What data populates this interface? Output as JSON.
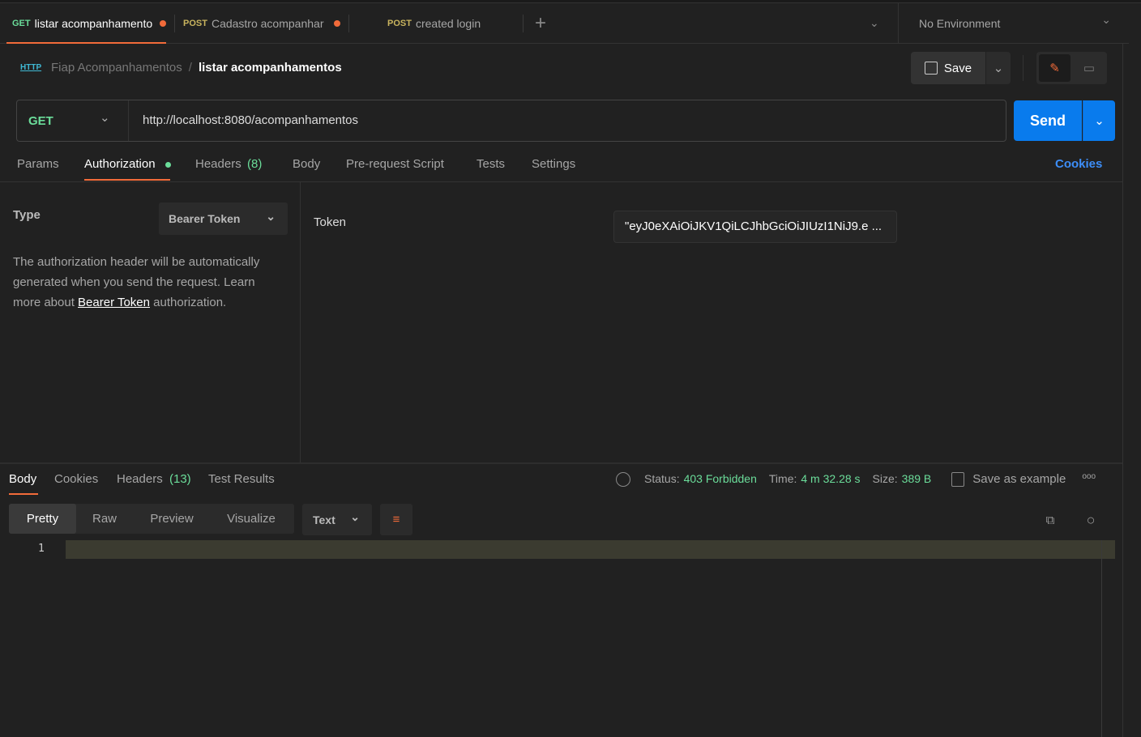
{
  "tabs": [
    {
      "method": "GET",
      "name": "listar acompanhamento",
      "dirty": true
    },
    {
      "method": "POST",
      "name": "Cadastro acompanhar",
      "dirty": true
    },
    {
      "method": "POST",
      "name": "created login",
      "dirty": false
    }
  ],
  "environment": "No Environment",
  "breadcrumb": {
    "collection": "Fiap Acompanhamentos",
    "separator": "/",
    "request": "listar acompanhamentos",
    "icon_text": "HTTP"
  },
  "toolbar": {
    "save": "Save"
  },
  "request": {
    "method": "GET",
    "url": "http://localhost:8080/acompanhamentos",
    "send": "Send"
  },
  "req_tabs": {
    "params": "Params",
    "authorization": "Authorization",
    "headers": "Headers",
    "headers_count": "(8)",
    "body": "Body",
    "prerequest": "Pre-request Script",
    "tests": "Tests",
    "settings": "Settings",
    "cookies": "Cookies"
  },
  "auth": {
    "type_label": "Type",
    "type_value": "Bearer Token",
    "desc1": "The authorization header will be automatically generated when you send the request. Learn more about ",
    "desc_link": "Bearer Token",
    "desc2": " authorization.",
    "token_label": "Token",
    "token_value": "\"eyJ0eXAiOiJKV1QiLCJhbGciOiJIUzI1NiJ9.e ..."
  },
  "response": {
    "tabs": {
      "body": "Body",
      "cookies": "Cookies",
      "headers": "Headers",
      "headers_count": "(13)",
      "tests": "Test Results"
    },
    "status_label": "Status:",
    "status": "403 Forbidden",
    "time_label": "Time:",
    "time": "4 m 32.28 s",
    "size_label": "Size:",
    "size": "389 B",
    "save_example": "Save as example",
    "views": [
      "Pretty",
      "Raw",
      "Preview",
      "Visualize"
    ],
    "format": "Text",
    "line": "1"
  },
  "colors": {
    "accent": "#f26b3a",
    "get": "#6bdd9a",
    "post": "#c9b45e",
    "send": "#097bed",
    "status": "#6bdd9a",
    "link": "#3d8ef8"
  }
}
